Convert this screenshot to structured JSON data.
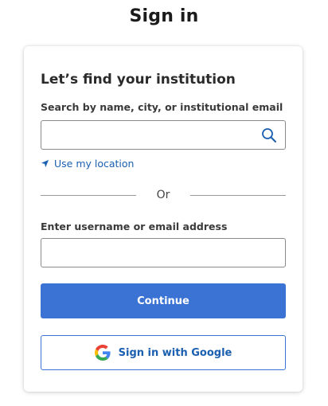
{
  "page": {
    "title": "Sign in"
  },
  "institution": {
    "heading": "Let’s find your institution",
    "search_label": "Search by name, city, or institutional email",
    "search_value": "",
    "search_placeholder": "",
    "search_icon": "search-icon",
    "location_link": "Use my location",
    "location_icon": "location-arrow-icon"
  },
  "divider": {
    "text": "Or"
  },
  "login": {
    "username_label": "Enter username or email address",
    "username_value": "",
    "username_placeholder": "",
    "continue_label": "Continue",
    "google_label": "Sign in with Google",
    "google_icon": "google-logo-icon"
  },
  "colors": {
    "primary": "#3b73d4",
    "link": "#1a5fb0",
    "google_blue": "#4285F4",
    "google_red": "#EA4335",
    "google_yellow": "#FBBC05",
    "google_green": "#34A853"
  }
}
